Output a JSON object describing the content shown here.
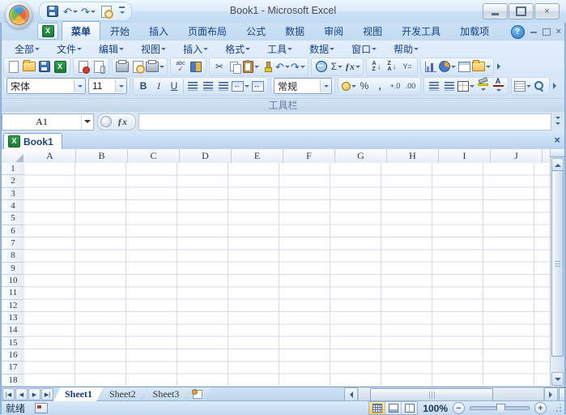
{
  "window": {
    "title": "Book1 - Microsoft Excel"
  },
  "ribbon": {
    "tabs": [
      {
        "label": "菜单",
        "active": true
      },
      {
        "label": "开始"
      },
      {
        "label": "插入"
      },
      {
        "label": "页面布局"
      },
      {
        "label": "公式"
      },
      {
        "label": "数据"
      },
      {
        "label": "审阅"
      },
      {
        "label": "视图"
      },
      {
        "label": "开发工具"
      },
      {
        "label": "加载项"
      }
    ],
    "menus": [
      "全部",
      "文件",
      "编辑",
      "视图",
      "插入",
      "格式",
      "工具",
      "数据",
      "窗口",
      "帮助"
    ],
    "group_label": "工具栏",
    "font_name": "宋体",
    "font_size": "11",
    "number_format": "常规"
  },
  "formula_bar": {
    "cell_ref": "A1",
    "formula": ""
  },
  "doc_tab": {
    "label": "Book1"
  },
  "grid": {
    "columns": [
      "A",
      "B",
      "C",
      "D",
      "E",
      "F",
      "G",
      "H",
      "I",
      "J"
    ],
    "rows": [
      "1",
      "2",
      "3",
      "4",
      "5",
      "6",
      "7",
      "8",
      "9",
      "10",
      "11",
      "12",
      "13",
      "14",
      "15",
      "16",
      "17",
      "18"
    ]
  },
  "sheets": {
    "tabs": [
      {
        "label": "Sheet1",
        "active": true
      },
      {
        "label": "Sheet2"
      },
      {
        "label": "Sheet3"
      }
    ]
  },
  "status": {
    "ready": "就绪",
    "zoom": "100%"
  },
  "icons": {
    "undo": "↶",
    "redo": "↷",
    "cut": "✂",
    "sum": "Σ",
    "fx": "ƒx",
    "bold": "B",
    "italic": "I",
    "underline": "U",
    "percent": "%",
    "comma": ",",
    "inc_decimal": "+.0",
    "dec_decimal": ".00",
    "sort_a": "A",
    "sort_z": "Z",
    "filter": "Y=",
    "font_color": "A",
    "fill_label": "",
    "spell_abc": "abc",
    "spell_check": "✓",
    "help": "?",
    "close": "×"
  },
  "colors": {
    "accent_blue": "#15428b",
    "active_view_button": "#fbc55a",
    "fill_color_bar": "#ffe400",
    "font_color_bar": "#e03020"
  }
}
